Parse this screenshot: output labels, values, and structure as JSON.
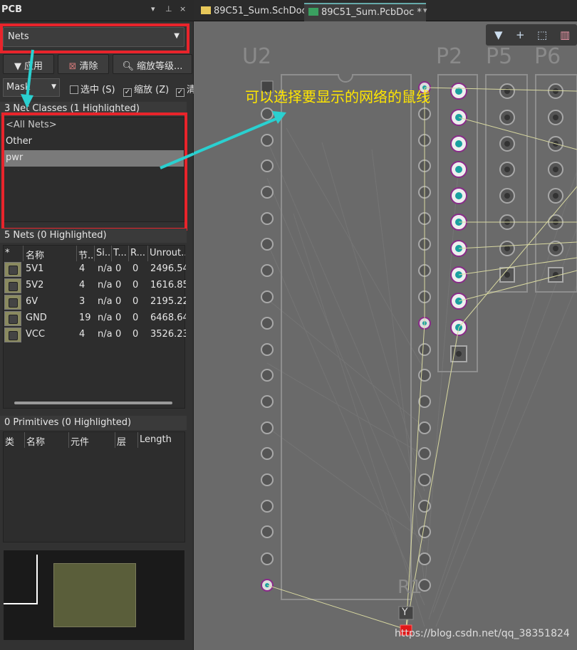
{
  "panel": {
    "title": "PCB",
    "controls": [
      "▾",
      "⊥",
      "×"
    ],
    "mode_dropdown": "Nets",
    "buttons": {
      "apply": "应用",
      "clear": "清除",
      "zoom": "缩放等级..."
    },
    "mask_dropdown": "Mask",
    "checkboxes": [
      {
        "label": "选中 (S)",
        "checked": false
      },
      {
        "label": "缩放 (Z)",
        "checked": true
      },
      {
        "label": "清",
        "checked": true
      }
    ],
    "net_classes": {
      "header": "3 Net Classes (1 Highlighted)",
      "items": [
        "<All Nets>",
        "Other",
        "pwr"
      ],
      "selected": "pwr"
    },
    "nets": {
      "header": "5 Nets (0 Highlighted)",
      "columns": [
        "*",
        "名称",
        "节...",
        "Si...",
        "T...",
        "R...",
        "Unrout..."
      ],
      "rows": [
        {
          "name": "5V1",
          "nodes": "4",
          "si": "n/a",
          "t": "0",
          "r": "0",
          "unrouted": "2496.54"
        },
        {
          "name": "5V2",
          "nodes": "4",
          "si": "n/a",
          "t": "0",
          "r": "0",
          "unrouted": "1616.85"
        },
        {
          "name": "6V",
          "nodes": "3",
          "si": "n/a",
          "t": "0",
          "r": "0",
          "unrouted": "2195.22"
        },
        {
          "name": "GND",
          "nodes": "19",
          "si": "n/a",
          "t": "0",
          "r": "0",
          "unrouted": "6468.64"
        },
        {
          "name": "VCC",
          "nodes": "4",
          "si": "n/a",
          "t": "0",
          "r": "0",
          "unrouted": "3526.23"
        }
      ]
    },
    "primitives": {
      "header": "0 Primitives (0 Highlighted)",
      "columns": [
        "类",
        "名称",
        "元件",
        "层",
        "Length"
      ]
    }
  },
  "editor": {
    "tabs": [
      {
        "label": "89C51_Sum.SchDoc",
        "active": false
      },
      {
        "label": "89C51_Sum.PcbDoc *",
        "active": true
      }
    ],
    "toolbar_icons": [
      "filter-icon",
      "plus-icon",
      "select-rect-icon",
      "chart-icon"
    ],
    "annotation": "可以选择要显示的网络的鼠线",
    "labels": {
      "u2": "U2",
      "p2": "P2",
      "p5": "P5",
      "p6": "P6",
      "r1": "R1",
      "r1_value": "Y"
    },
    "watermark": "https://blog.csdn.net/qq_38351824"
  },
  "colors": {
    "highlight_box": "#e8242b",
    "arrow": "#2ad0d0",
    "annotation": "#ffe600",
    "pad_highlight": "#1aa0a0",
    "ratsnest": "#d8d8a0"
  }
}
